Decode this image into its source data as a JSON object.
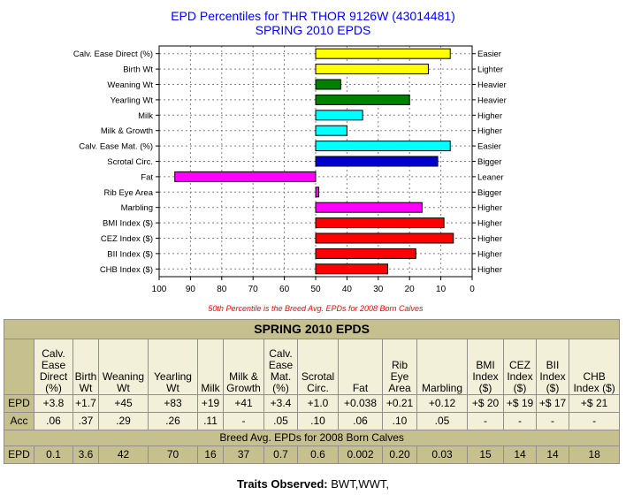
{
  "chart_data": {
    "type": "bar",
    "orientation": "horizontal",
    "title": "EPD Percentiles for THR THOR 9126W (43014481)",
    "subtitle": "SPRING 2010 EPDS",
    "categories": [
      "Calv. Ease Direct (%)",
      "Birth Wt",
      "Weaning Wt",
      "Yearling Wt",
      "Milk",
      "Milk & Growth",
      "Calv. Ease Mat. (%)",
      "Scrotal Circ.",
      "Fat",
      "Rib Eye Area",
      "Marbling",
      "BMI Index ($)",
      "CEZ Index ($)",
      "BII Index ($)",
      "CHB Index ($)"
    ],
    "right_labels": [
      "Easier",
      "Lighter",
      "Heavier",
      "Heavier",
      "Higher",
      "Higher",
      "Easier",
      "Bigger",
      "Leaner",
      "Bigger",
      "Higher",
      "Higher",
      "Higher",
      "Higher",
      "Higher"
    ],
    "baseline": 50,
    "values": [
      7,
      14,
      42,
      20,
      35,
      40,
      7,
      11,
      95,
      49,
      16,
      9,
      6,
      18,
      27
    ],
    "colors": [
      "#ffff00",
      "#ffff00",
      "#008000",
      "#008000",
      "#00ffff",
      "#00ffff",
      "#00ffff",
      "#0000cd",
      "#ff00ff",
      "#ff00ff",
      "#ff00ff",
      "#ff0000",
      "#ff0000",
      "#ff0000",
      "#ff0000"
    ],
    "xlim": [
      100,
      0
    ],
    "xticks": [
      100,
      90,
      80,
      70,
      60,
      50,
      40,
      30,
      20,
      10,
      0
    ],
    "grid": true,
    "note": "50th Percentile is the Breed Avg. EPDs for 2008 Born Calves"
  },
  "table": {
    "title": "SPRING 2010 EPDS",
    "headers": [
      "Calv. Ease Direct (%)",
      "Birth Wt",
      "Weaning Wt",
      "Yearling Wt",
      "Milk",
      "Milk & Growth",
      "Calv. Ease Mat. (%)",
      "Scrotal Circ.",
      "Fat",
      "Rib Eye Area",
      "Marbling",
      "BMI Index ($)",
      "CEZ Index ($)",
      "BII Index ($)",
      "CHB Index ($)"
    ],
    "epd_label": "EPD",
    "epd": [
      "+3.8",
      "+1.7",
      "+45",
      "+83",
      "+19",
      "+41",
      "+3.4",
      "+1.0",
      "+0.038",
      "+0.21",
      "+0.12",
      "+$ 20",
      "+$ 19",
      "+$ 17",
      "+$ 21"
    ],
    "acc_label": "Acc",
    "acc": [
      ".06",
      ".37",
      ".29",
      ".26",
      ".11",
      "-",
      ".05",
      ".10",
      ".06",
      ".10",
      ".05",
      "-",
      "-",
      "-",
      "-"
    ],
    "avg_title": "Breed Avg. EPDs for 2008 Born Calves",
    "avg_label": "EPD",
    "avg": [
      "0.1",
      "3.6",
      "42",
      "70",
      "16",
      "37",
      "0.7",
      "0.6",
      "0.002",
      "0.20",
      "0.03",
      "15",
      "14",
      "14",
      "18"
    ]
  },
  "traits": {
    "label": "Traits Observed:",
    "value": " BWT,WWT,"
  }
}
